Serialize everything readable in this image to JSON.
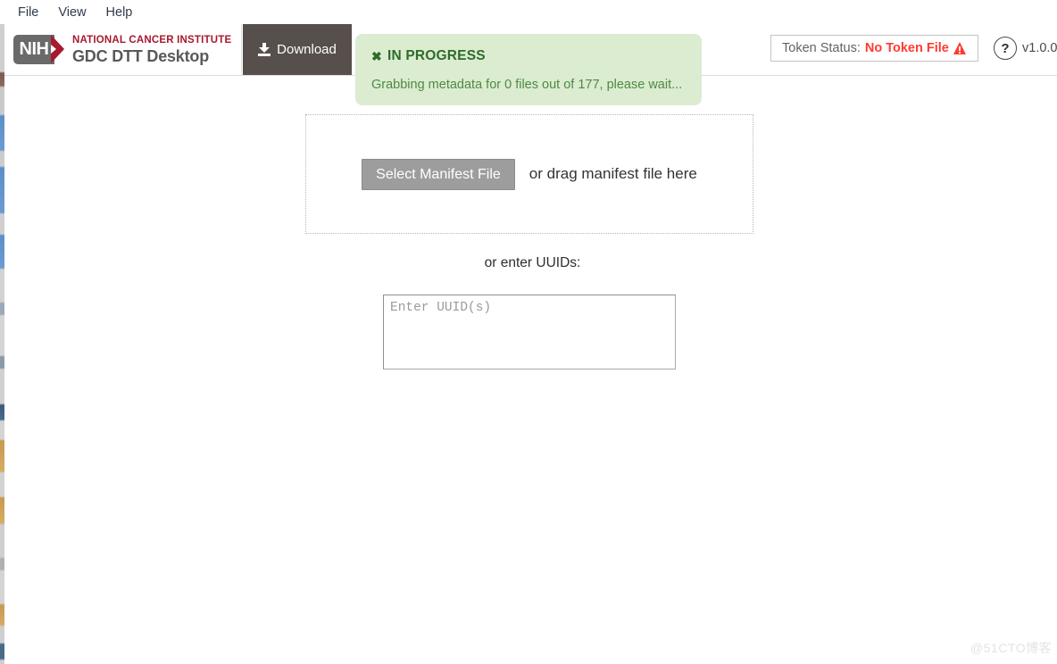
{
  "menubar": {
    "items": [
      {
        "label": "File"
      },
      {
        "label": "View"
      },
      {
        "label": "Help"
      }
    ]
  },
  "header": {
    "brand": {
      "mark_text": "NIH",
      "line1": "NATIONAL CANCER INSTITUTE",
      "line2": "GDC DTT Desktop"
    },
    "tabs": [
      {
        "label": "Download",
        "icon": "download-icon",
        "active": true
      }
    ],
    "token_status": {
      "label": "Token Status:",
      "value": "No Token File",
      "icon": "warning-triangle-icon",
      "value_color": "#ff3b30"
    },
    "help": {
      "icon": "question-mark-icon",
      "label": "?"
    },
    "version": "v1.0.0"
  },
  "notification": {
    "close_icon": "close-icon",
    "close_label": "✖",
    "title": "IN PROGRESS",
    "message": "Grabbing metadata for 0 files out of 177, please wait...",
    "background": "#dbecd1",
    "title_color": "#2f6b2a",
    "text_color": "#4e8a42",
    "progress": {
      "files_done": 0,
      "files_total": 177
    }
  },
  "main": {
    "dropzone": {
      "button_label": "Select Manifest File",
      "hint_text": "or drag manifest file here"
    },
    "uuid": {
      "label": "or enter UUIDs:",
      "placeholder": "Enter UUID(s)",
      "value": ""
    }
  },
  "watermark": {
    "text": "@51CTO博客"
  }
}
